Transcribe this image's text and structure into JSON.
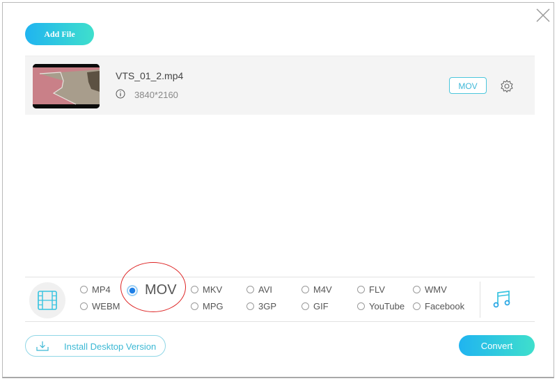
{
  "header": {
    "add_file_label": "Add File",
    "close_icon": "close-icon"
  },
  "file": {
    "name": "VTS_01_2.mp4",
    "resolution": "3840*2160",
    "output_format": "MOV",
    "info_icon": "info-icon",
    "settings_icon": "gear-icon"
  },
  "formats": {
    "video_icon": "film-icon",
    "audio_icon": "music-note-icon",
    "selected": "MOV",
    "options": [
      {
        "label": "MP4",
        "selected": false
      },
      {
        "label": "MOV",
        "selected": true
      },
      {
        "label": "MKV",
        "selected": false
      },
      {
        "label": "AVI",
        "selected": false
      },
      {
        "label": "M4V",
        "selected": false
      },
      {
        "label": "FLV",
        "selected": false
      },
      {
        "label": "WMV",
        "selected": false
      },
      {
        "label": "WEBM",
        "selected": false
      },
      {
        "label": "MPG",
        "selected": false
      },
      {
        "label": "3GP",
        "selected": false
      },
      {
        "label": "GIF",
        "selected": false
      },
      {
        "label": "YouTube",
        "selected": false
      },
      {
        "label": "Facebook",
        "selected": false
      }
    ]
  },
  "footer": {
    "install_label": "Install Desktop Version",
    "convert_label": "Convert"
  },
  "colors": {
    "accent_start": "#20b4f0",
    "accent_end": "#3fdfcc",
    "annotation": "#dd2222"
  }
}
